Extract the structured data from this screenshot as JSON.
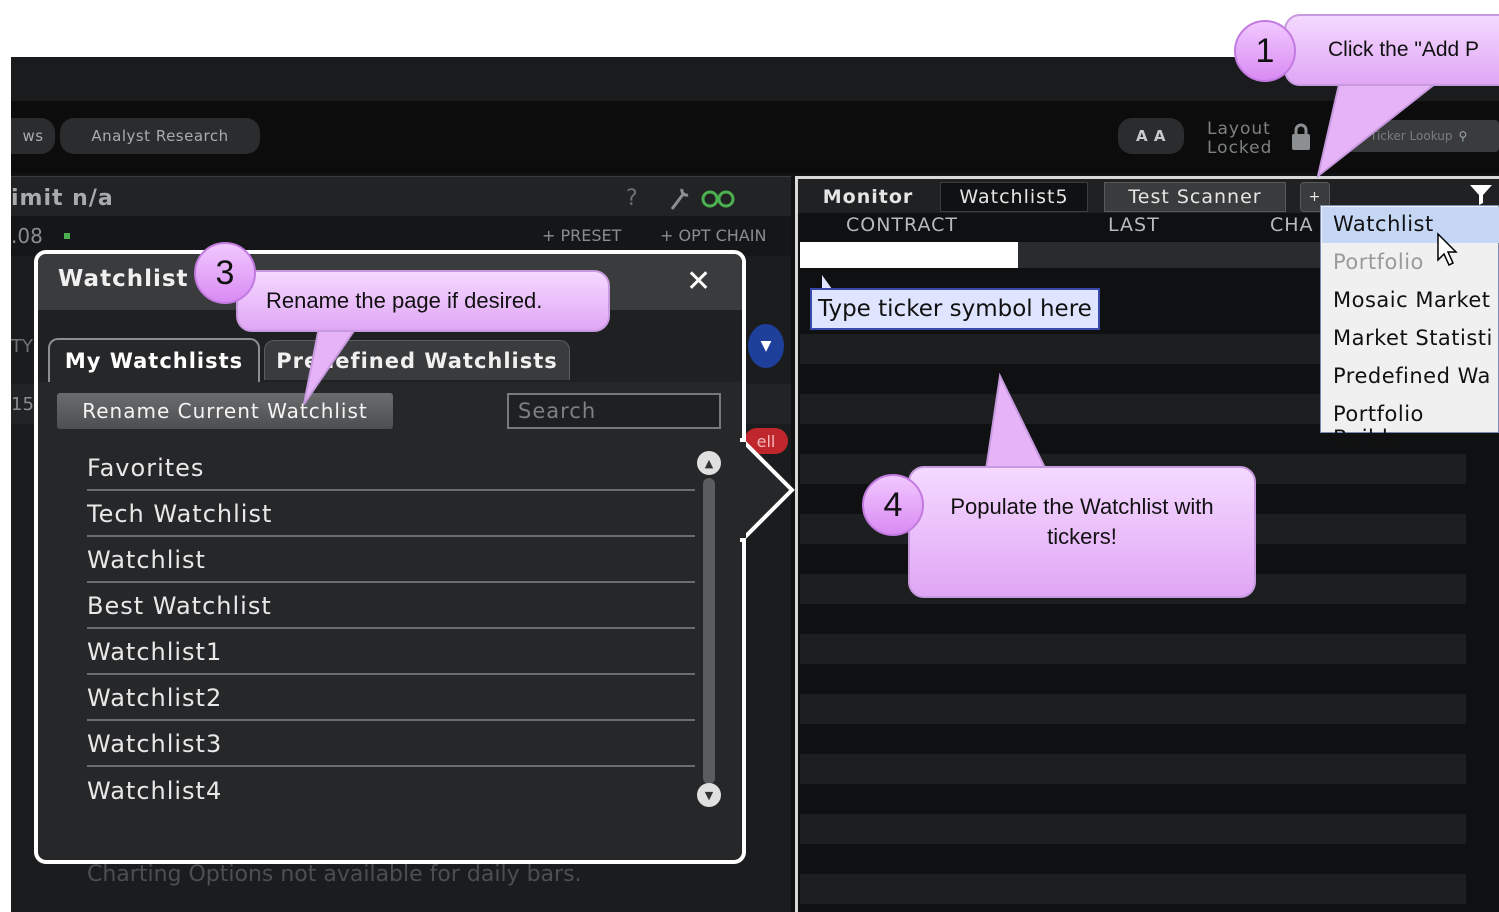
{
  "toolbar": {
    "news_tab_fragment": "ws",
    "analyst_research": "Analyst Research",
    "font_size_button": "A A",
    "layout_locked_line1": "Layout",
    "layout_locked_line2": "Locked",
    "ticker_lookup_placeholder": "Ticker Lookup"
  },
  "left_panel": {
    "header_text": "imit n/a",
    "help_mark": "?",
    "price_fragment": ".08",
    "preset": "PRESET",
    "opt_chain": "OPT CHAIN",
    "side_fragment_1": "TY",
    "side_fragment_2": "15",
    "charting_note": "Charting Options not available for daily bars.",
    "sell_fragment": "ell"
  },
  "dialog": {
    "title": "Watchlist L",
    "close": "✕",
    "tabs": [
      "My Watchlists",
      "Predefined Watchlists"
    ],
    "rename_button": "Rename Current Watchlist",
    "search_placeholder": "Search",
    "items": [
      "Favorites",
      "Tech Watchlist",
      "Watchlist",
      "Best Watchlist",
      "Watchlist1",
      "Watchlist2",
      "Watchlist3",
      "Watchlist4"
    ]
  },
  "monitor": {
    "panel_title": "Monitor",
    "tabs": [
      "Watchlist5",
      "Test Scanner"
    ],
    "add_tab": "+",
    "columns": [
      "CONTRACT",
      "LAST",
      "CHA"
    ],
    "ticker_hint": "Type ticker symbol here"
  },
  "menu": {
    "items": [
      "Watchlist",
      "Portfolio",
      "Mosaic Market",
      "Market Statisti",
      "Predefined Wa",
      "Portfolio Builde"
    ]
  },
  "callouts": {
    "c1_number": "1",
    "c1_text": "Click the \"Add P",
    "c3_number": "3",
    "c3_text": "Rename the page if desired.",
    "c4_number": "4",
    "c4_text_line1": "Populate the Watchlist with",
    "c4_text_line2": "tickers!"
  },
  "colors": {
    "accent_green": "#4caf50",
    "callout_purple": "#e0a6f5",
    "sell_red": "#c0272d"
  }
}
